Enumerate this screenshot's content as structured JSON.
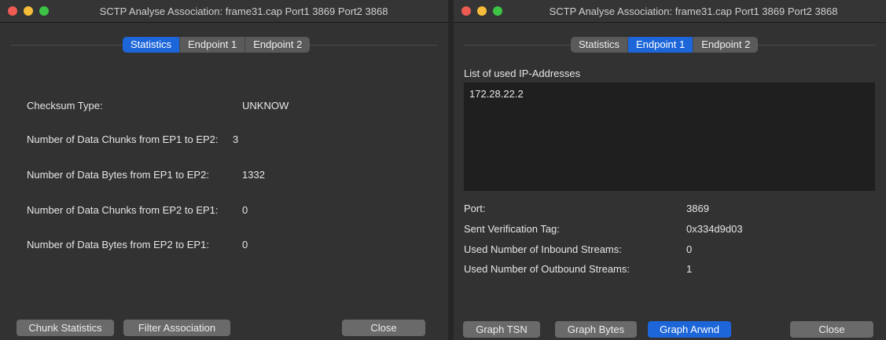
{
  "left_window": {
    "title": "SCTP Analyse Association: frame31.cap Port1 3869 Port2 3868",
    "tabs": [
      "Statistics",
      "Endpoint 1",
      "Endpoint 2"
    ],
    "active_tab": "Statistics",
    "rows": [
      {
        "label": "Checksum Type:",
        "value": "UNKNOW"
      },
      {
        "label": "Number of Data Chunks from EP1 to EP2:",
        "value": "3"
      },
      {
        "label": "Number of Data Bytes from EP1 to EP2:",
        "value": "1332"
      },
      {
        "label": "Number of Data Chunks from EP2 to EP1:",
        "value": "0"
      },
      {
        "label": "Number of Data Bytes from EP2 to EP1:",
        "value": "0"
      }
    ],
    "buttons": {
      "chunk_statistics": "Chunk Statistics",
      "filter_association": "Filter Association",
      "close": "Close"
    }
  },
  "right_window": {
    "title": "SCTP Analyse Association: frame31.cap Port1 3869 Port2 3868",
    "tabs": [
      "Statistics",
      "Endpoint 1",
      "Endpoint 2"
    ],
    "active_tab": "Endpoint 1",
    "ip_list_label": "List of used IP-Addresses",
    "ip_addresses": [
      "172.28.22.2"
    ],
    "rows": [
      {
        "label": "Port:",
        "value": "3869"
      },
      {
        "label": "Sent Verification Tag:",
        "value": "0x334d9d03"
      },
      {
        "label": "Used Number of Inbound Streams:",
        "value": "0"
      },
      {
        "label": "Used Number of Outbound Streams:",
        "value": "1"
      }
    ],
    "buttons": {
      "graph_tsn": "Graph TSN",
      "graph_bytes": "Graph Bytes",
      "graph_arwnd": "Graph Arwnd",
      "close": "Close"
    }
  },
  "colors": {
    "window_bg": "#323232",
    "accent_blue": "#1d66d9",
    "button_gray": "#6a6a6a",
    "list_bg": "#1f1f1f",
    "traffic_red": "#ee5b52",
    "traffic_yellow": "#f6bd3a",
    "traffic_green": "#3dc345"
  }
}
